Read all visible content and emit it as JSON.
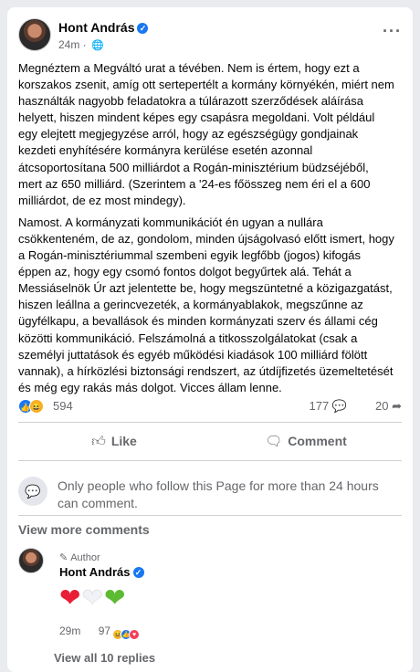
{
  "post": {
    "author": "Hont András",
    "time": "24m",
    "more_icon": "more-horizontal-icon",
    "paragraphs": [
      "Megnéztem a Megváltó urat a tévében. Nem is értem, hogy ezt a korszakos zsenit, amíg ott sertepertélt a kormány környékén, miért nem használták nagyobb feladatokra a túlárazott szerződések aláírása helyett, hiszen mindent képes egy csapásra megoldani. Volt például egy elejtett megjegyzése arról, hogy az egészségügy gondjainak kezdeti enyhítésére kormányra kerülése esetén azonnal átcsoportosítana 500 milliárdot a Rogán-minisztérium büdzséjéből, mert az 650 milliárd. (Szerintem a '24-es főösszeg nem éri el a 600 milliárdot, de ez most mindegy).",
      "Namost. A kormányzati kommunikációt én ugyan a nullára csökkenteném, de az, gondolom, minden újságolvasó előtt ismert, hogy a Rogán-minisztériummal szembeni egyik legfőbb (jogos) kifogás éppen az, hogy egy csomó fontos dolgot begyűrtek alá. Tehát a Messiáselnök Úr azt jelentette be, hogy megszüntetné a közigazgatást, hiszen leállna a gerincvezeték, a kormányablakok, megszűnne az ügyfélkapu, a bevallások és minden kormányzati szerv és állami cég közötti kommunikáció. Felszámolná a titkosszolgálatokat (csak a személyi juttatások és egyéb működési kiadások 100 milliárd fölött vannak), a hírközlési biztonsági rendszert, az útdíjfizetés üzemeltetését és még egy rakás más dolgot. Vicces állam lenne."
    ]
  },
  "stats": {
    "reactions": "594",
    "comments": "177",
    "shares": "20"
  },
  "actions": {
    "like": "Like",
    "comment": "Comment"
  },
  "notice": "Only people who follow this Page for more than 24 hours can comment.",
  "view_more_comments": "View more comments",
  "comment": {
    "badge": "Author",
    "author": "Hont András",
    "hearts": [
      "❤",
      "🤍",
      "💚"
    ],
    "time": "29m",
    "reactions": "97"
  },
  "view_replies": "View all 10 replies",
  "colors": {
    "accent": "#1877f2",
    "secondary_text": "#65676b",
    "divider": "#ced0d4"
  }
}
